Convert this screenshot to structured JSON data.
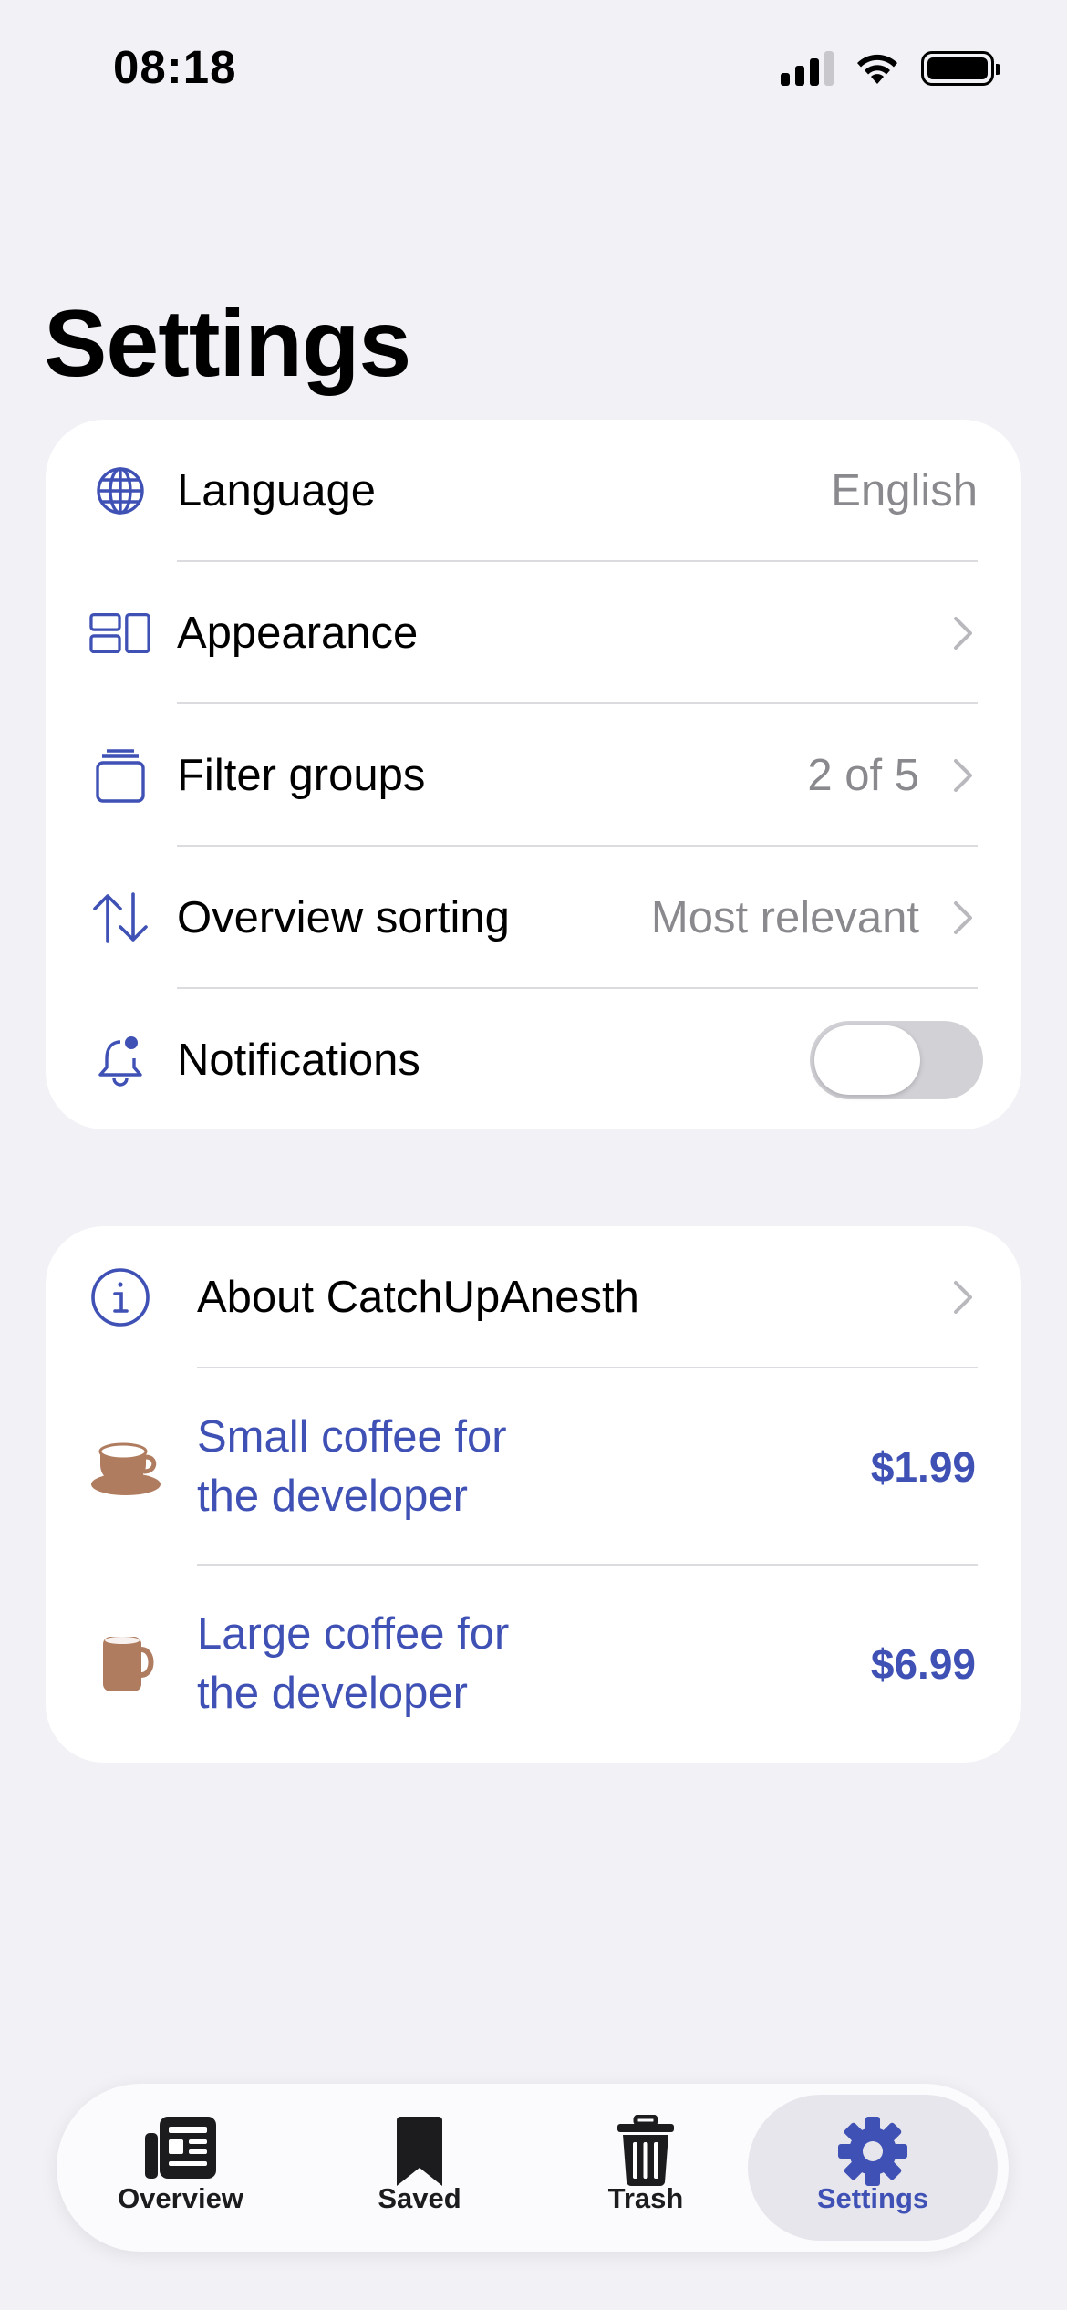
{
  "status_bar": {
    "time": "08:18"
  },
  "page": {
    "title": "Settings"
  },
  "settings_group": [
    {
      "label": "Language",
      "value": "English",
      "icon": "globe-icon"
    },
    {
      "label": "Appearance",
      "value": "",
      "icon": "layout-icon"
    },
    {
      "label": "Filter groups",
      "value": "2 of 5",
      "icon": "stack-icon"
    },
    {
      "label": "Overview sorting",
      "value": "Most relevant",
      "icon": "sort-arrows-icon"
    },
    {
      "label": "Notifications",
      "value": "",
      "icon": "bell-badge-icon",
      "toggle_on": false
    }
  ],
  "about_group": {
    "about_label": "About CatchUpAnesth",
    "small_coffee": {
      "line1": "Small coffee for",
      "line2": "the developer",
      "price": "$1.99"
    },
    "large_coffee": {
      "line1": "Large coffee for",
      "line2": "the developer",
      "price": "$6.99"
    }
  },
  "tab_bar": {
    "tabs": [
      {
        "label": "Overview",
        "icon": "newspaper-icon"
      },
      {
        "label": "Saved",
        "icon": "bookmark-icon"
      },
      {
        "label": "Trash",
        "icon": "trash-icon"
      },
      {
        "label": "Settings",
        "icon": "gear-icon",
        "active": true
      }
    ]
  },
  "colors": {
    "accent": "#3f51b5",
    "coffee": "#b07c5f",
    "background": "#f1f1f6",
    "secondary_text": "#8a8a8e"
  }
}
